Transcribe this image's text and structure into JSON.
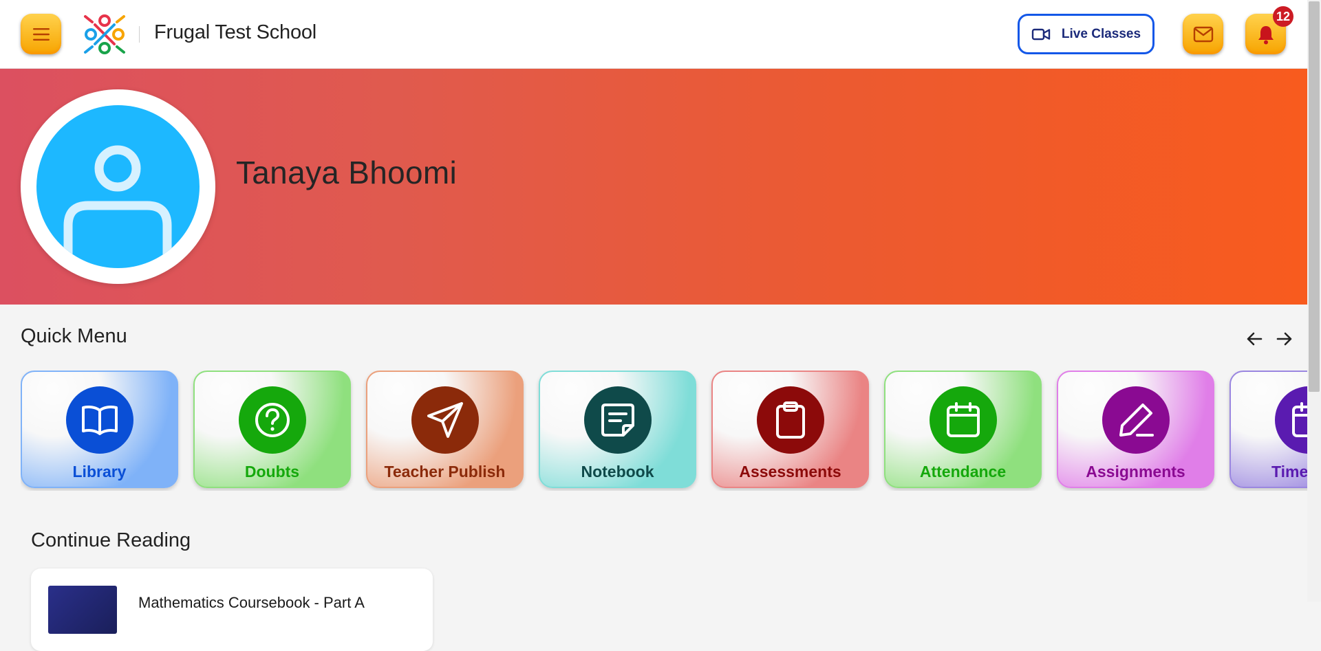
{
  "header": {
    "school_name": "Frugal Test School",
    "live_classes_label": "Live Classes",
    "notification_count": "12",
    "menu_icon": "hamburger-icon",
    "mail_icon": "mail-icon",
    "bell_icon": "bell-icon",
    "accent_color": "#f7a400",
    "live_border_color": "#1357e8"
  },
  "profile": {
    "name": "Tanaya Bhoomi",
    "avatar_icon": "user-avatar-icon",
    "banner_gradient": [
      "#dc5060",
      "#f85b1e"
    ]
  },
  "quick_menu": {
    "title": "Quick Menu",
    "items": [
      {
        "label": "Library",
        "icon": "book-open-icon",
        "bg": "#7fb2f8",
        "circle": "#0a4fd6",
        "text": "#0a4fd6"
      },
      {
        "label": "Doubts",
        "icon": "question-circle-icon",
        "bg": "#8fe07e",
        "circle": "#15a80c",
        "text": "#15a80c"
      },
      {
        "label": "Teacher Publish",
        "icon": "send-icon",
        "bg": "#eba07c",
        "circle": "#8b2a0a",
        "text": "#8b2a0a"
      },
      {
        "label": "Notebook",
        "icon": "sticky-note-icon",
        "bg": "#7fddd8",
        "circle": "#0f4a4a",
        "text": "#0f4a4a"
      },
      {
        "label": "Assessments",
        "icon": "clipboard-icon",
        "bg": "#ea8484",
        "circle": "#8c0a0a",
        "text": "#8c0a0a"
      },
      {
        "label": "Attendance",
        "icon": "calendar-icon",
        "bg": "#8fe07e",
        "circle": "#15a80c",
        "text": "#15a80c"
      },
      {
        "label": "Assignments",
        "icon": "pen-icon",
        "bg": "#e07ee8",
        "circle": "#8a0a92",
        "text": "#8a0a92"
      },
      {
        "label": "Timetable",
        "icon": "calendar-icon",
        "bg": "#9a86e0",
        "circle": "#5a1bb0",
        "text": "#5a1bb0"
      }
    ]
  },
  "continue_reading": {
    "title": "Continue Reading",
    "books": [
      {
        "title": "Mathematics Coursebook - Part A"
      }
    ]
  }
}
